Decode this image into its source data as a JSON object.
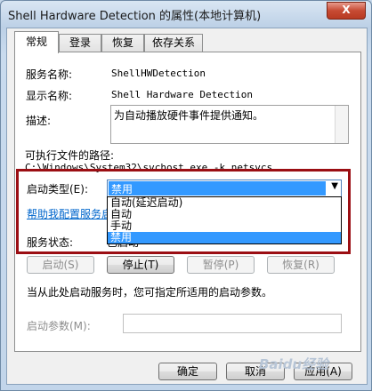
{
  "window": {
    "title": "Shell Hardware Detection 的属性(本地计算机)",
    "close": "X"
  },
  "tabs": [
    "常规",
    "登录",
    "恢复",
    "依存关系"
  ],
  "general": {
    "service_name_label": "服务名称:",
    "service_name": "ShellHWDetection",
    "display_name_label": "显示名称:",
    "display_name": "Shell Hardware Detection",
    "description_label": "描述:",
    "description": "为自动播放硬件事件提供通知。",
    "exe_path_label": "可执行文件的路径:",
    "exe_path": "C:\\Windows\\System32\\svchost.exe -k netsvcs",
    "startup_type_label": "启动类型(E):",
    "startup_type_value": "禁用",
    "startup_options": [
      "自动(延迟启动)",
      "自动",
      "手动",
      "禁用"
    ],
    "help_link": "帮助我配置服务启",
    "service_status_label": "服务状态:",
    "service_status_value": "已启动",
    "buttons": {
      "start": "启动(S)",
      "stop": "停止(T)",
      "pause": "暂停(P)",
      "resume": "恢复(R)"
    },
    "hint": "当从此处启动服务时，您可指定所适用的启动参数。",
    "start_params_label": "启动参数(M):"
  },
  "dialog_buttons": {
    "ok": "确定",
    "cancel": "取消",
    "apply": "应用(A)"
  },
  "watermark": "Baidu经验"
}
